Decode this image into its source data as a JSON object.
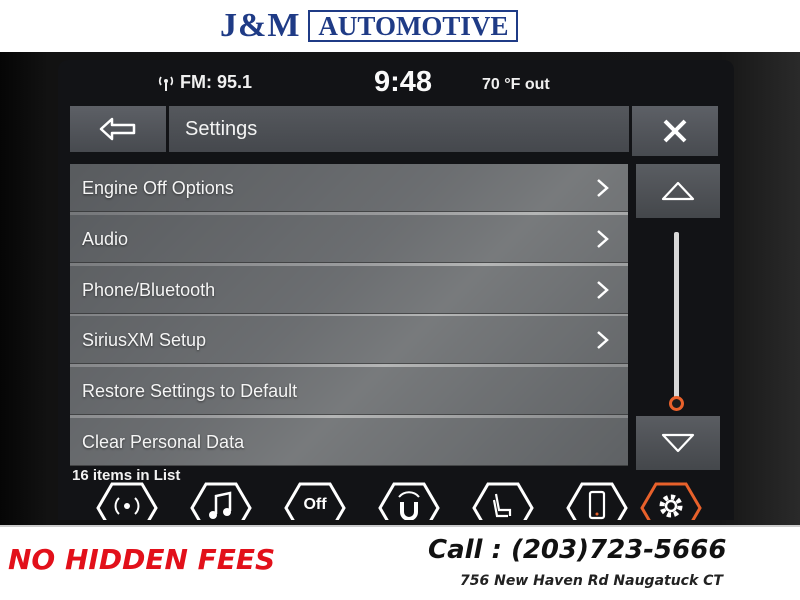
{
  "dealer": {
    "name_main": "J&M",
    "name_sub": "AUTOMOTIVE"
  },
  "status_bar": {
    "radio": "FM: 95.1",
    "time": "9:48",
    "temperature": "70 °F out"
  },
  "header": {
    "title": "Settings"
  },
  "menu": {
    "items": [
      {
        "label": "Engine Off Options",
        "has_submenu": true
      },
      {
        "label": "Audio",
        "has_submenu": true
      },
      {
        "label": "Phone/Bluetooth",
        "has_submenu": true
      },
      {
        "label": "SiriusXM Setup",
        "has_submenu": true
      },
      {
        "label": "Restore Settings to Default",
        "has_submenu": false
      },
      {
        "label": "Clear Personal Data",
        "has_submenu": false
      }
    ],
    "count_text": "16 items in List"
  },
  "bottom_nav": {
    "items": [
      {
        "icon": "radio-icon"
      },
      {
        "icon": "music-icon"
      },
      {
        "icon": "off-icon",
        "label": "Off"
      },
      {
        "icon": "uconnect-icon"
      },
      {
        "icon": "seat-controls-icon"
      },
      {
        "icon": "phone-icon"
      },
      {
        "icon": "settings-gear-icon",
        "active": true
      }
    ]
  },
  "footer": {
    "promo": "NO HIDDEN FEES",
    "phone": "Call : (203)723-5666",
    "address": "756 New Haven Rd Naugatuck CT"
  },
  "colors": {
    "accent": "#e8612b",
    "dealer_blue": "#1f3b86",
    "promo_red": "#e2101a"
  }
}
